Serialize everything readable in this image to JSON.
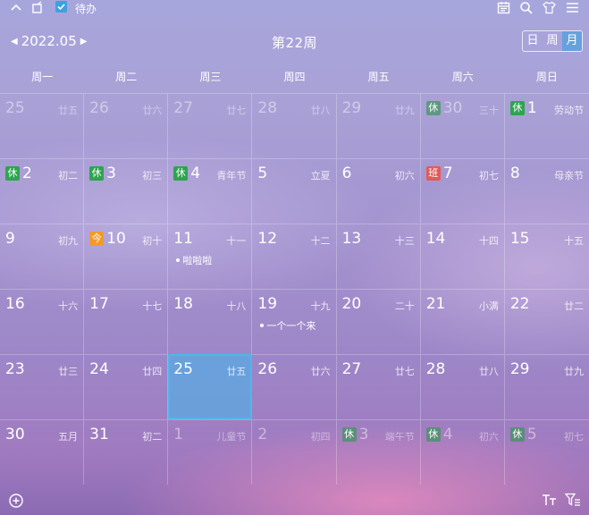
{
  "topbar": {
    "todo_label": "待办",
    "icons": [
      "chevron-up-icon",
      "pin-icon",
      "checkbox-icon",
      "calendar-icon",
      "search-icon",
      "shirt-icon",
      "menu-icon"
    ]
  },
  "header": {
    "year_month": "2022.05",
    "week_title": "第22周",
    "views": [
      "日",
      "周",
      "月"
    ],
    "active_view": "月"
  },
  "weekdays": [
    "周一",
    "周二",
    "周三",
    "周四",
    "周五",
    "周六",
    "周日"
  ],
  "days": [
    {
      "day": "25",
      "lunar": "廿五",
      "dim": true
    },
    {
      "day": "26",
      "lunar": "廿六",
      "dim": true
    },
    {
      "day": "27",
      "lunar": "廿七",
      "dim": true
    },
    {
      "day": "28",
      "lunar": "廿八",
      "dim": true
    },
    {
      "day": "29",
      "lunar": "廿九",
      "dim": true
    },
    {
      "day": "30",
      "lunar": "三十",
      "dim": true,
      "badge": "休",
      "badge_type": "rest"
    },
    {
      "day": "1",
      "lunar": "劳动节",
      "badge": "休",
      "badge_type": "rest"
    },
    {
      "day": "2",
      "lunar": "初二",
      "badge": "休",
      "badge_type": "rest"
    },
    {
      "day": "3",
      "lunar": "初三",
      "badge": "休",
      "badge_type": "rest"
    },
    {
      "day": "4",
      "lunar": "青年节",
      "badge": "休",
      "badge_type": "rest"
    },
    {
      "day": "5",
      "lunar": "立夏"
    },
    {
      "day": "6",
      "lunar": "初六"
    },
    {
      "day": "7",
      "lunar": "初七",
      "badge": "班",
      "badge_type": "work"
    },
    {
      "day": "8",
      "lunar": "母亲节"
    },
    {
      "day": "9",
      "lunar": "初九"
    },
    {
      "day": "10",
      "lunar": "初十",
      "badge": "今",
      "badge_type": "today"
    },
    {
      "day": "11",
      "lunar": "十一",
      "event": "啦啦啦"
    },
    {
      "day": "12",
      "lunar": "十二"
    },
    {
      "day": "13",
      "lunar": "十三"
    },
    {
      "day": "14",
      "lunar": "十四"
    },
    {
      "day": "15",
      "lunar": "十五"
    },
    {
      "day": "16",
      "lunar": "十六"
    },
    {
      "day": "17",
      "lunar": "十七"
    },
    {
      "day": "18",
      "lunar": "十八"
    },
    {
      "day": "19",
      "lunar": "十九",
      "event": "一个一个来"
    },
    {
      "day": "20",
      "lunar": "二十"
    },
    {
      "day": "21",
      "lunar": "小满"
    },
    {
      "day": "22",
      "lunar": "廿二"
    },
    {
      "day": "23",
      "lunar": "廿三"
    },
    {
      "day": "24",
      "lunar": "廿四"
    },
    {
      "day": "25",
      "lunar": "廿五",
      "selected": true
    },
    {
      "day": "26",
      "lunar": "廿六"
    },
    {
      "day": "27",
      "lunar": "廿七"
    },
    {
      "day": "28",
      "lunar": "廿八"
    },
    {
      "day": "29",
      "lunar": "廿九"
    },
    {
      "day": "30",
      "lunar": "五月"
    },
    {
      "day": "31",
      "lunar": "初二"
    },
    {
      "day": "1",
      "lunar": "儿童节",
      "dim": true
    },
    {
      "day": "2",
      "lunar": "初四",
      "dim": true
    },
    {
      "day": "3",
      "lunar": "端午节",
      "dim": true,
      "badge": "休",
      "badge_type": "rest"
    },
    {
      "day": "4",
      "lunar": "初六",
      "dim": true,
      "badge": "休",
      "badge_type": "rest"
    },
    {
      "day": "5",
      "lunar": "初七",
      "dim": true,
      "badge": "休",
      "badge_type": "rest"
    }
  ],
  "bottombar": {
    "icons": [
      "add-icon",
      "text-size-icon",
      "filter-icon"
    ]
  },
  "colors": {
    "rest_badge": "#2ea44f",
    "work_badge": "#e05a5a",
    "today_badge": "#f29b2a",
    "selected_cell": "#5aaae1"
  }
}
